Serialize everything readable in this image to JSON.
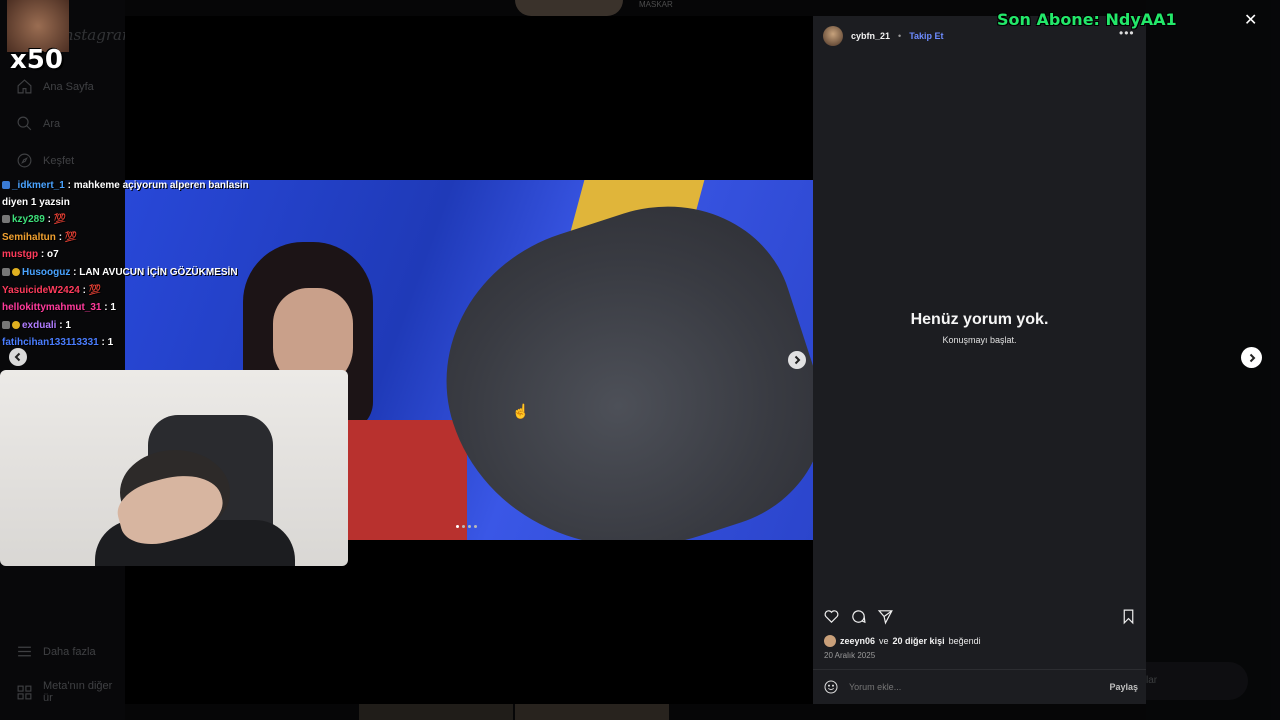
{
  "sidebar": {
    "logo": "Instagram",
    "items": [
      {
        "label": "Ana Sayfa",
        "icon": "home-icon"
      },
      {
        "label": "Ara",
        "icon": "search-icon"
      },
      {
        "label": "Keşfet",
        "icon": "compass-icon"
      }
    ],
    "bottom_items": [
      {
        "label": "Daha fazla",
        "icon": "menu-icon"
      },
      {
        "label": "Meta'nın diğer ür",
        "icon": "meta-icon"
      }
    ]
  },
  "post": {
    "username": "cybfn_21",
    "follow_label": "Takip Et",
    "empty_title": "Henüz yorum yok.",
    "empty_subtitle": "Konuşmayı başlat.",
    "likes_user": "zeeyn06",
    "likes_connector": "ve",
    "likes_others": "20 diğer kişi",
    "likes_suffix": "beğendi",
    "date": "20 Aralık 2025",
    "comment_placeholder": "Yorum ekle...",
    "share_label": "Paylaş",
    "slide_count": 4,
    "current_slide": 1
  },
  "stream": {
    "subscriber_text": "Son Abone: NdyAA1",
    "multiplier": "x50",
    "top_label": "MASKAR",
    "chat": [
      {
        "name": "_idkmert_1",
        "color": "#4aa3ff",
        "text": ": mahkeme açiyorum alperen banlasin"
      },
      {
        "name": "",
        "color": "#ffffff",
        "text": "diyen 1 yazsin"
      },
      {
        "name": "kzy289",
        "color": "#3de07a",
        "text": ": 💯"
      },
      {
        "name": "Semihaltun",
        "color": "#f0a030",
        "text": ": 💯"
      },
      {
        "name": "mustgp",
        "color": "#ff3b5c",
        "text": ": o7"
      },
      {
        "name": "Husooguz",
        "color": "#4aa3ff",
        "text": ": LAN AVUCUN İÇİN GÖZÜKMESİN"
      },
      {
        "name": "YasuicideW2424",
        "color": "#ff3b5c",
        "text": ": 💯"
      },
      {
        "name": "hellokittymahmut_31",
        "color": "#ff3b9c",
        "text": ": 1"
      },
      {
        "name": "exduali",
        "color": "#b07cff",
        "text": ": 1"
      },
      {
        "name": "fatihcihan133113331",
        "color": "#4a7dff",
        "text": ": 1"
      }
    ]
  },
  "right_pill_text": "lar",
  "colors": {
    "accent": "#6d8cff",
    "subscriber": "#23e86a"
  }
}
